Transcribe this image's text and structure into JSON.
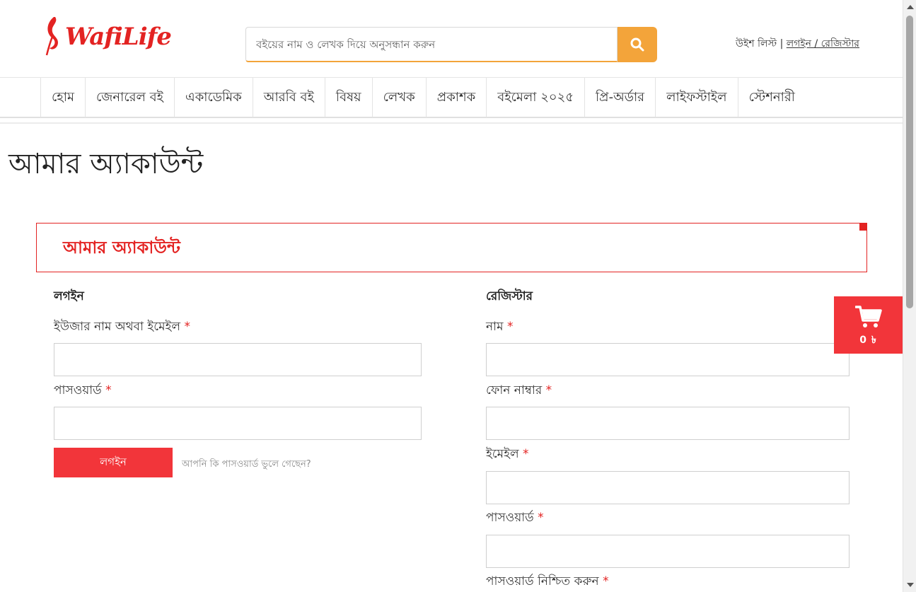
{
  "brand": {
    "logo_text": "WafiLife",
    "brand_color": "#e32322",
    "accent_color": "#f3a43a"
  },
  "search": {
    "placeholder": "বইয়ের নাম ও লেখক দিয়ে অনুসন্ধান করুন",
    "value": "",
    "button_icon": "search-icon"
  },
  "top_links": {
    "wishlist": "উইশ লিস্ট",
    "separator": " | ",
    "login_register": "লগইন / রেজিস্টার"
  },
  "nav": {
    "items": [
      {
        "label": "হোম"
      },
      {
        "label": "জেনারেল বই"
      },
      {
        "label": "একাডেমিক"
      },
      {
        "label": "আরবি বই"
      },
      {
        "label": "বিষয়"
      },
      {
        "label": "লেখক"
      },
      {
        "label": "প্রকাশক"
      },
      {
        "label": "বইমেলা ২০২৫"
      },
      {
        "label": "প্রি-অর্ডার"
      },
      {
        "label": "লাইফস্টাইল"
      },
      {
        "label": "স্টেশনারী"
      }
    ]
  },
  "page": {
    "title": "আমার অ্যাকাউন্ট",
    "box_title": "আমার অ্যাকাউন্ট"
  },
  "login": {
    "heading": "লগইন",
    "username_label": "ইউজার নাম অথবা ইমেইল",
    "password_label": "পাসওয়ার্ড",
    "required_mark": "*",
    "submit_label": "লগইন",
    "forgot_link": "আপনি কি পাসওয়ার্ড ভুলে গেছেন?"
  },
  "register": {
    "heading": "রেজিস্টার",
    "name_label": "নাম",
    "phone_label": "ফোন নাম্বার",
    "email_label": "ইমেইল",
    "password_label": "পাসওয়ার্ড",
    "confirm_label": "পাসওয়ার্ড নিশ্চিত করুন",
    "required_mark": "*"
  },
  "cart": {
    "icon": "cart-icon",
    "count_text": "0 ৳"
  }
}
